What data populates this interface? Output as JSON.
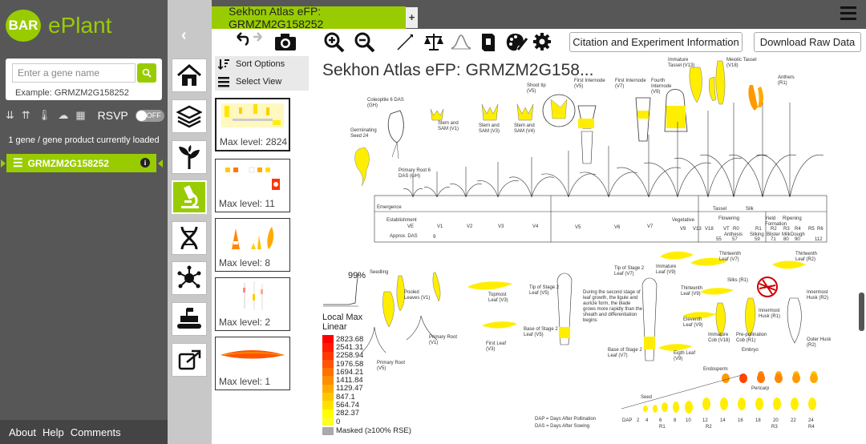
{
  "left_panel": {
    "badge": "BAR",
    "app_name": "ePlant",
    "search_placeholder": "Enter a gene name",
    "example": "Example: GRMZM2G158252",
    "rsvp_label": "RSVP",
    "rsvp_state": "OFF",
    "loaded_text": "1 gene / gene product currently loaded",
    "gene": "GRMZM2G158252",
    "footer": [
      "About",
      "Help",
      "Comments"
    ]
  },
  "tab": {
    "label": "Sekhon Atlas eFP: GRMZM2G158252",
    "add": "+"
  },
  "toolbar": {
    "citation": "Citation and Experiment Information",
    "download": "Download Raw Data"
  },
  "sort_menu": {
    "sort": "Sort Options",
    "select": "Select View"
  },
  "thumbnails": [
    {
      "label": "Max level: 2824"
    },
    {
      "label": "Max level: 11"
    },
    {
      "label": "Max level: 8"
    },
    {
      "label": "Max level: 2"
    },
    {
      "label": "Max level: 1"
    }
  ],
  "plot": {
    "title": "Sekhon Atlas eFP: GRMZM2G158...",
    "max_value_label": "99%",
    "legend_title": "Local Max",
    "legend_subtitle": "Linear",
    "legend_values": [
      "2823.68",
      "2541.31",
      "2258.94",
      "1976.58",
      "1694.21",
      "1411.84",
      "1129.47",
      "847.1",
      "564.74",
      "282.37",
      "0"
    ],
    "legend_colors": [
      "#ff0000",
      "#ff1c00",
      "#ff3800",
      "#ff5500",
      "#ff7100",
      "#ff8d00",
      "#ffaa00",
      "#ffc600",
      "#ffe200",
      "#ffff00",
      "#ffff20"
    ],
    "masked_label": "Masked (≥100% RSE)",
    "stage_labels": {
      "germinating": "Germinating Seed 24",
      "coleoptile": "Coleoptile 6 DAS (GH)",
      "primary_root_gh": "Primary Root 6 DAS (GH)",
      "stem_v1": "Stem and SAM (V1)",
      "stem_v3": "Stem and SAM (V3)",
      "stem_v4": "Stem and SAM (V4)",
      "shoot_tip": "Shoot tip (V5)",
      "first_internode_v5": "First Internode (V5)",
      "first_internode_v7": "First Internode (V7)",
      "fourth_internode": "Fourth Internode (V9)",
      "immature_tassel": "Immature Tassel (V13)",
      "meiotic_tassel": "Meiotic Tassel (V18)",
      "anthers": "Anthers (R1)",
      "seedling": "Seedling",
      "pooled_leaves": "Pooled Leaves (V1)",
      "primary_root_v5": "Primary Root (V5)",
      "primary_root_v1": "Primary Root (V1)",
      "topmost_leaf": "Topmost Leaf (V3)",
      "first_leaf": "First Leaf (V3)",
      "tip_stage2_v5": "Tip of Stage 2 Leaf (V5)",
      "base_stage2_v5": "Base of Stage 2 Leaf (V5)",
      "tip_stage2_v7": "Tip of Stage 2 Leaf (V7)",
      "base_stage2_v7": "Base of Stage 2 Leaf (V7)",
      "immature_leaf": "Immature Leaf (V9)",
      "thirteenth_v7": "Thirteenth Leaf (V7)",
      "thirteenth_v9": "Thirteenth Leaf (V9)",
      "thirteenth_r2": "Thirteenth Leaf (R2)",
      "eleventh": "Eleventh Leaf (V9)",
      "eighth": "Eigth Leaf (V9)",
      "silks": "Silks (R1)",
      "innermost_husk_r1": "Innermost Husk (R1)",
      "innermost_husk_r2": "Innermost Husk (R2)",
      "outer_husk": "Outer Husk (R2)",
      "immature_cob": "Immature Cob (V18)",
      "pre_pollination": "Pre-pollination Cob (R1)",
      "embryo": "Embryo",
      "endosperm": "Endosperm",
      "pericarp": "Pericarp",
      "seed": "Seed",
      "dap_note": "DAP = Days After Pollination",
      "das_note": "DAS = Days After Sowing",
      "leaf_note": "During the second stage of leaf growth, the ligule and auricle form, the blade grows more rapidly than the sheath and differentiation begins"
    },
    "timeline": {
      "emergence": "Emergence",
      "establishment": "Establishment",
      "vegetative": "Vegetative",
      "flowering": "Flowering",
      "yield": "Yield Formation",
      "ripening": "Ripening",
      "approx_das": "Approx. DAS",
      "tassel": "Tassel",
      "silk": "Silk",
      "stages": [
        "VE",
        "V1",
        "V2",
        "V3",
        "V4",
        "V5",
        "V6",
        "V7",
        "V9",
        "V13",
        "V18",
        "VT",
        "R0",
        "R1",
        "R2",
        "R3",
        "R4",
        "R5",
        "R6"
      ],
      "stage_subs": [
        "Anthesis",
        "Silking",
        "Blister",
        "Milk",
        "Dough"
      ],
      "das_values": [
        "9",
        "55",
        "57",
        "59",
        "71",
        "80",
        "90",
        "112"
      ]
    },
    "dap_axis": {
      "label": "DAP",
      "values": [
        "2",
        "4",
        "6",
        "8",
        "10",
        "12",
        "14",
        "16",
        "18",
        "20",
        "22",
        "24"
      ],
      "r_labels": [
        "R1",
        "R2",
        "R3",
        "R4"
      ]
    }
  }
}
